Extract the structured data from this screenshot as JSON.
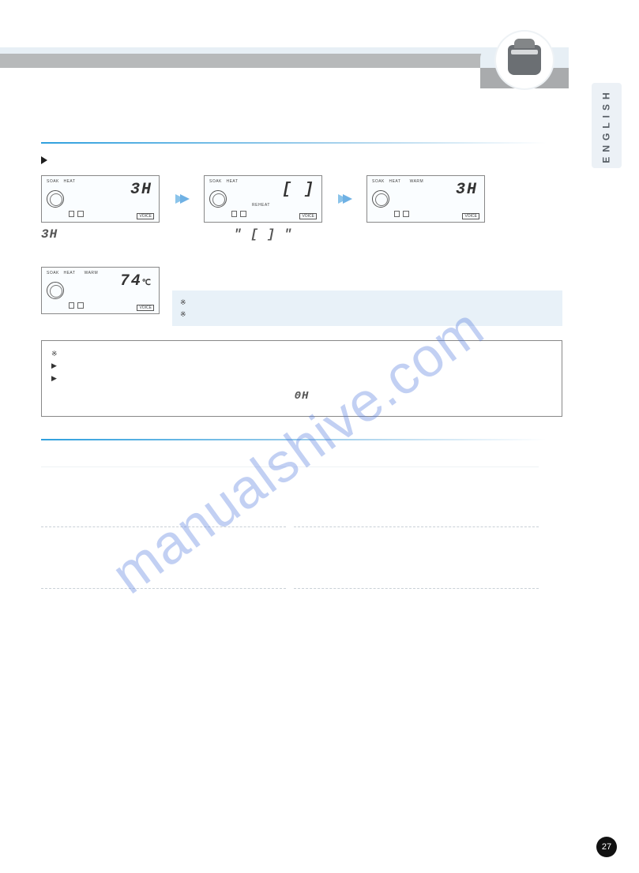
{
  "lang_tab": "ENGLISH",
  "watermark": "manualshive.com",
  "page_number": "27",
  "lcd": {
    "labels": {
      "soak": "SOAK",
      "heat": "HEAT",
      "warm": "WARM",
      "reheat": "REHEAT",
      "voice": "VOICE"
    },
    "seg1": "3H",
    "seg2": "[ ]",
    "seg3": "3H",
    "seg4": "74",
    "unit4": "℃"
  },
  "captions": {
    "c1": "3H",
    "c2_quote": "\" [ ] \""
  },
  "segstyle_0h": "0H",
  "bullet_marker": "▶",
  "aster_marker": "※"
}
